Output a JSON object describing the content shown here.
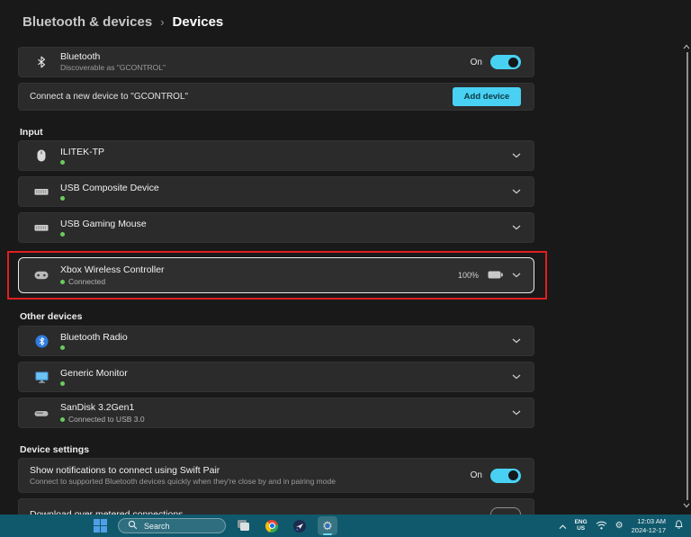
{
  "page": {
    "breadcrumb": {
      "parent": "Bluetooth & devices",
      "separator": "›",
      "current": "Devices"
    }
  },
  "bluetooth_card": {
    "title": "Bluetooth",
    "subtitle": "Discoverable as \"GCONTROL\"",
    "toggle_label": "On"
  },
  "connect_card": {
    "label": "Connect a new device to \"GCONTROL\"",
    "button_label": "Add device"
  },
  "input_section": {
    "label": "Input",
    "devices": [
      {
        "name": "ILITEK-TP"
      },
      {
        "name": "USB Composite Device"
      },
      {
        "name": "USB Gaming Mouse"
      },
      {
        "name": "Xbox Wireless Controller",
        "status": "Connected",
        "battery": "100%"
      }
    ]
  },
  "other_section": {
    "label": "Other devices",
    "devices": [
      {
        "name": "Bluetooth Radio"
      },
      {
        "name": "Generic Monitor"
      },
      {
        "name": "SanDisk 3.2Gen1",
        "status": "Connected to USB 3.0"
      }
    ]
  },
  "settings_section": {
    "label": "Device settings",
    "swift_pair": {
      "title": "Show notifications to connect using Swift Pair",
      "subtitle": "Connect to supported Bluetooth devices quickly when they're close by and in pairing mode",
      "toggle_label": "On"
    },
    "metered": {
      "title": "Download over metered connections"
    }
  },
  "taskbar": {
    "search_label": "Search",
    "tray": {
      "lang_top": "ENG",
      "lang_bottom": "US",
      "time": "12:03 AM",
      "date": "2024-12-17"
    }
  },
  "colors": {
    "accent": "#49d1f3",
    "taskbar": "#10596c",
    "annotation": "#e01e1e",
    "status_green": "#6ccb5f"
  }
}
